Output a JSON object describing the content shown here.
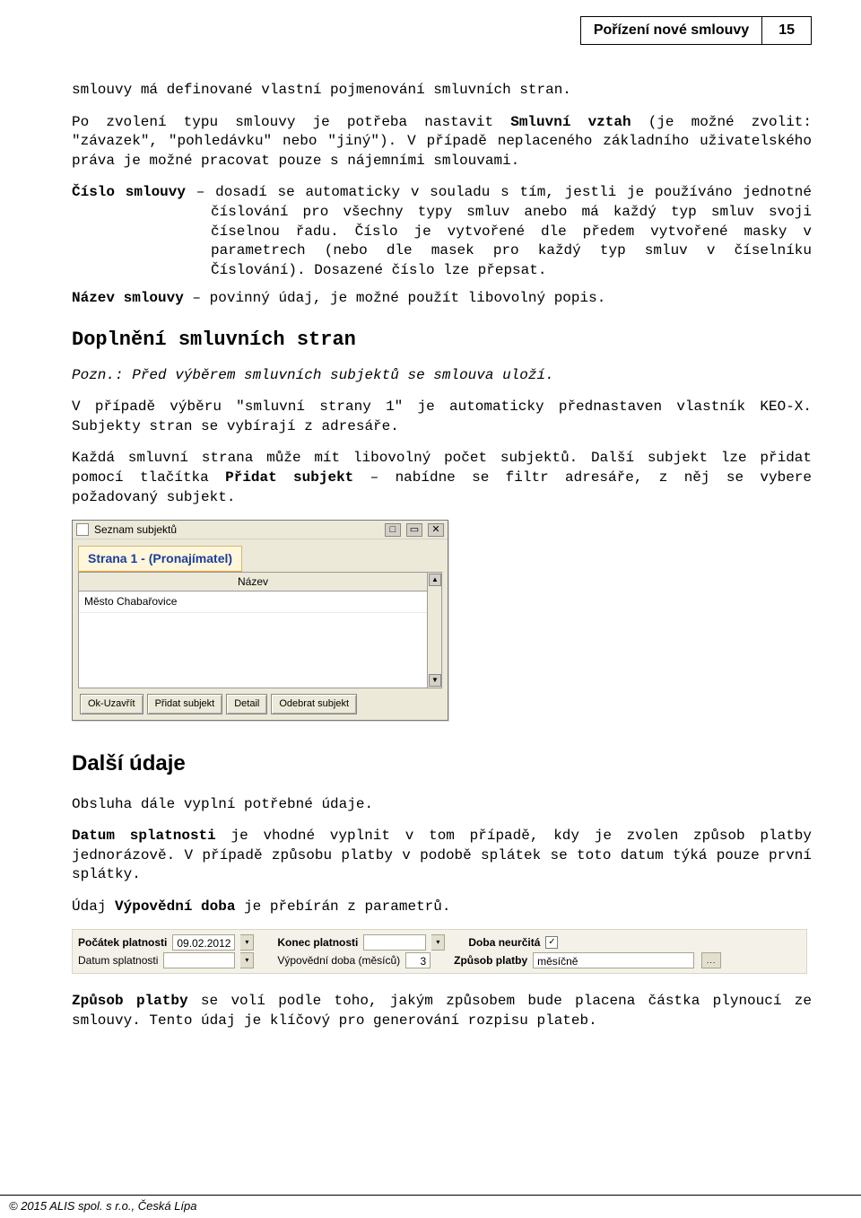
{
  "header": {
    "title": "Pořízení nové smlouvy",
    "page_number": "15"
  },
  "para_intro_1": "smlouvy má definované vlastní pojmenování smluvních stran.",
  "para_intro_2a": "Po zvolení typu smlouvy je potřeba nastavit ",
  "para_intro_2b": "Smluvní vztah",
  "para_intro_2c": " (je možné zvolit: \"závazek\", \"pohledávku\" nebo \"jiný\"). V případě neplaceného základního uživatelského práva je možné pracovat pouze s nájemními smlouvami.",
  "cislo_smlouvy_label": "Číslo smlouvy",
  "cislo_smlouvy_text": " – dosadí se automaticky v souladu s tím, jestli je používáno jednotné číslování pro všechny typy smluv anebo má každý typ smluv svoji číselnou řadu. Číslo je vytvořené dle předem vytvořené masky v parametrech (nebo dle masek pro každý typ smluv v číselníku Číslování). Dosazené číslo lze přepsat.",
  "nazev_smlouvy_label": "Název smlouvy",
  "nazev_smlouvy_text": " – povinný údaj, je možné použít libovolný popis.",
  "h2_doplneni": "Doplnění smluvních stran",
  "note_italic": "Pozn.: Před výběrem smluvních subjektů se smlouva uloží.",
  "para_d1": "V případě výběru \"smluvní strany 1\" je automaticky přednastaven vlastník KEO-X. Subjekty stran se vybírají z adresáře.",
  "para_d2a": "Každá smluvní strana může mít libovolný počet subjektů. Další subjekt lze přidat pomocí tlačítka ",
  "para_d2b": "Přidat subjekt",
  "para_d2c": " – nabídne se filtr adresáře, z něj se vybere požadovaný subjekt.",
  "subjects_window": {
    "title": "Seznam subjektů",
    "tab": "Strana 1 - (Pronajímatel)",
    "col_header": "Název",
    "rows": [
      "Město Chabařovice"
    ],
    "buttons": {
      "ok": "Ok-Uzavřít",
      "add": "Přidat subjekt",
      "detail": "Detail",
      "remove": "Odebrat subjekt"
    }
  },
  "h2_dalsi": "Další údaje",
  "para_du1": "Obsluha dále vyplní potřebné údaje.",
  "para_du2a": "Datum splatnosti",
  "para_du2b": " je vhodné vyplnit v tom případě, kdy je zvolen způsob platby jednorázově. V případě způsobu platby v podobě splátek se toto datum týká pouze první splátky.",
  "para_du3a": "Údaj ",
  "para_du3b": "Výpovědní doba",
  "para_du3c": " je přebírán z parametrů.",
  "fields": {
    "pocatek_label": "Počátek platnosti",
    "pocatek_value": "09.02.2012",
    "konec_label": "Konec platnosti",
    "konec_value": "",
    "doba_label": "Doba neurčitá",
    "doba_checked": "✓",
    "splatnost_label": "Datum splatnosti",
    "splatnost_value": "",
    "vypovedni_label": "Výpovědní doba (měsíců)",
    "vypovedni_value": "3",
    "zpusob_label": "Způsob platby",
    "zpusob_value": "měsíčně"
  },
  "para_last_a": "Způsob platby",
  "para_last_b": " se volí podle toho, jakým způsobem bude placena částka plynoucí ze smlouvy. Tento údaj je klíčový pro generování rozpisu plateb.",
  "footer": "© 2015 ALIS spol. s r.o., Česká Lípa"
}
